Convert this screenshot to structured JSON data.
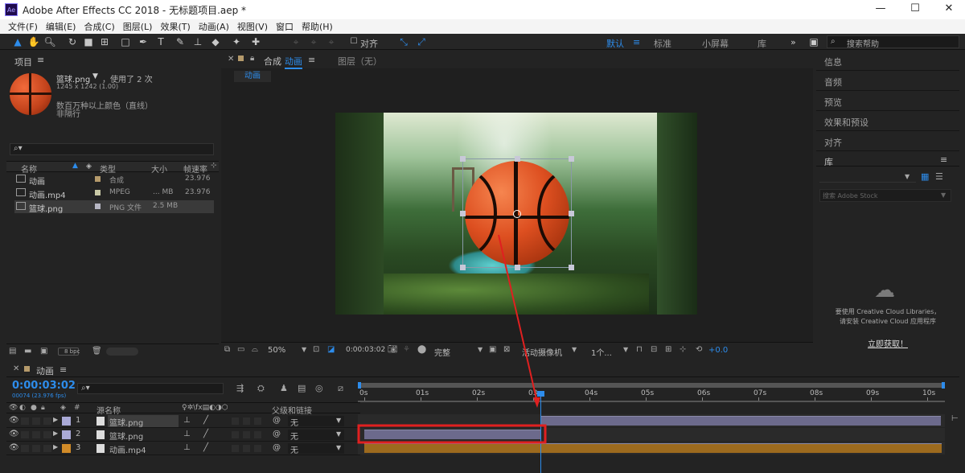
{
  "window": {
    "title": "Adobe After Effects CC 2018 - 无标题项目.aep *",
    "logo": "Ae",
    "minimize": "—",
    "maximize": "☐",
    "close": "✕"
  },
  "menu": [
    "文件(F)",
    "编辑(E)",
    "合成(C)",
    "图层(L)",
    "效果(T)",
    "动画(A)",
    "视图(V)",
    "窗口",
    "帮助(H)"
  ],
  "toolbar": {
    "align_label": "对齐",
    "workspaces": [
      "默认",
      "标准",
      "小屏幕",
      "库"
    ],
    "search_placeholder": "搜索帮助"
  },
  "project": {
    "tab": "项目",
    "asset_name": "篮球.png",
    "asset_used": "，使用了 2 次",
    "asset_dims": "1245 x 1242 (1.00)",
    "asset_color": "数百万种以上颜色（直线）",
    "asset_interlace": "非隔行",
    "search_placeholder": "",
    "columns": {
      "name": "名称",
      "type": "类型",
      "size": "大小",
      "fps": "帧速率"
    },
    "items": [
      {
        "name": "动画",
        "type": "合成",
        "size": "",
        "fps": "23.976",
        "color": "#b59a6b"
      },
      {
        "name": "动画.mp4",
        "type": "MPEG",
        "size": "... MB",
        "fps": "23.976",
        "color": "#c9c9a6"
      },
      {
        "name": "篮球.png",
        "type": "PNG 文件",
        "size": "2.5 MB",
        "fps": "",
        "color": "#b7b7c4"
      }
    ],
    "bpc": "8 bpc"
  },
  "composition": {
    "tab_prefix": "合成",
    "tab_name": "动画",
    "layer_tab": "图层（无）",
    "breadcrumb": "动画",
    "zoom": "50%",
    "timecode": "0:00:03:02",
    "quality": "完整",
    "camera": "活动摄像机",
    "views": "1个...",
    "exposure": "+0.0"
  },
  "right_panels": [
    "信息",
    "音频",
    "预览",
    "效果和预设",
    "对齐"
  ],
  "library": {
    "tab": "库",
    "search_placeholder": "搜索 Adobe Stock",
    "message_line1": "要使用 Creative Cloud Libraries，",
    "message_line2": "请安装 Creative Cloud 应用程序",
    "cta": "立即获取！"
  },
  "timeline": {
    "tab": "动画",
    "timecode": "0:00:03:02",
    "frame_info": "00074 (23.976 fps)",
    "search_placeholder": "",
    "columns": {
      "source": "源名称",
      "parent": "父级和链接"
    },
    "layers": [
      {
        "num": "1",
        "name": "篮球.png",
        "parent": "无",
        "color": "#a9a9d6"
      },
      {
        "num": "2",
        "name": "篮球.png",
        "parent": "无",
        "color": "#a9a9d6"
      },
      {
        "num": "3",
        "name": "动画.mp4",
        "parent": "无",
        "color": "#d18b28"
      }
    ],
    "ruler": [
      "0s",
      "01s",
      "02s",
      "03s",
      "04s",
      "05s",
      "06s",
      "07s",
      "08s",
      "09s",
      "10s"
    ],
    "duration_sec": 10,
    "playhead_sec": 3.13,
    "bars": [
      {
        "layer": 1,
        "start": 3.13,
        "end": 10.25,
        "color": "#6c6a8c"
      },
      {
        "layer": 2,
        "start": 0,
        "end": 3.13,
        "color": "#6c6a8c"
      },
      {
        "layer": 3,
        "start": 0,
        "end": 10.25,
        "color": "#9c6a1e"
      }
    ]
  },
  "colors": {
    "accent": "#2d8ceb",
    "highlight": "#e02020"
  }
}
